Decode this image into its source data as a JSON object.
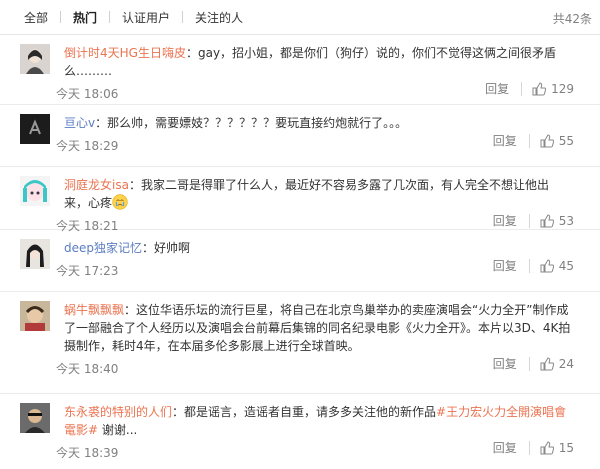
{
  "tabs": [
    "全部",
    "热门",
    "认证用户",
    "关注的人"
  ],
  "active_tab": "热门",
  "total": "共42条",
  "reply_label": "回复",
  "comments": [
    {
      "user": "倒计时4天HG生日嗨皮",
      "colon": "：",
      "text": "gay，招小姐，都是你们（狗仔）说的，你们不觉得这俩之间很矛盾么………",
      "time": "今天 18:06",
      "likes": "129"
    },
    {
      "user": "亘心v",
      "colon": "：",
      "text": "那么帅，需要嫖妓？？？？？？要玩直接约炮就行了。。。",
      "time": "今天 18:29",
      "likes": "55"
    },
    {
      "user": "洞庭龙女isa",
      "colon": "：",
      "text": "我家二哥是得罪了什么人，最近好不容易多露了几次面，有人完全不想让他出来，心疼",
      "time": "今天 18:21",
      "likes": "53"
    },
    {
      "user": "deep独家记忆",
      "colon": "：",
      "text": "好帅啊",
      "time": "今天 17:23",
      "likes": "45"
    },
    {
      "user": "蜗牛飘飘飘",
      "colon": "：",
      "text": "这位华语乐坛的流行巨星，将自己在北京鸟巢举办的卖座演唱会“火力全开”制作成了一部融合了个人经历以及演唱会台前幕后集锦的同名纪录电影《火力全开》。本片以3D、4K拍摄制作，耗时4年，在本届多伦多影展上进行全球首映。",
      "time": "今天 18:40",
      "likes": "24"
    },
    {
      "user": "东永裘的特别的人们",
      "colon": "：",
      "text": "都是谣言，造谣者自重，请多多关注他的新作品",
      "hashtag": "#王力宏火力全開演唱會電影#",
      "tail": " 谢谢...",
      "time": "今天 18:39",
      "likes": "15"
    }
  ],
  "colors": {
    "username": "#eb7350",
    "username_blue": "#5b7cc2",
    "muted": "#808080"
  }
}
